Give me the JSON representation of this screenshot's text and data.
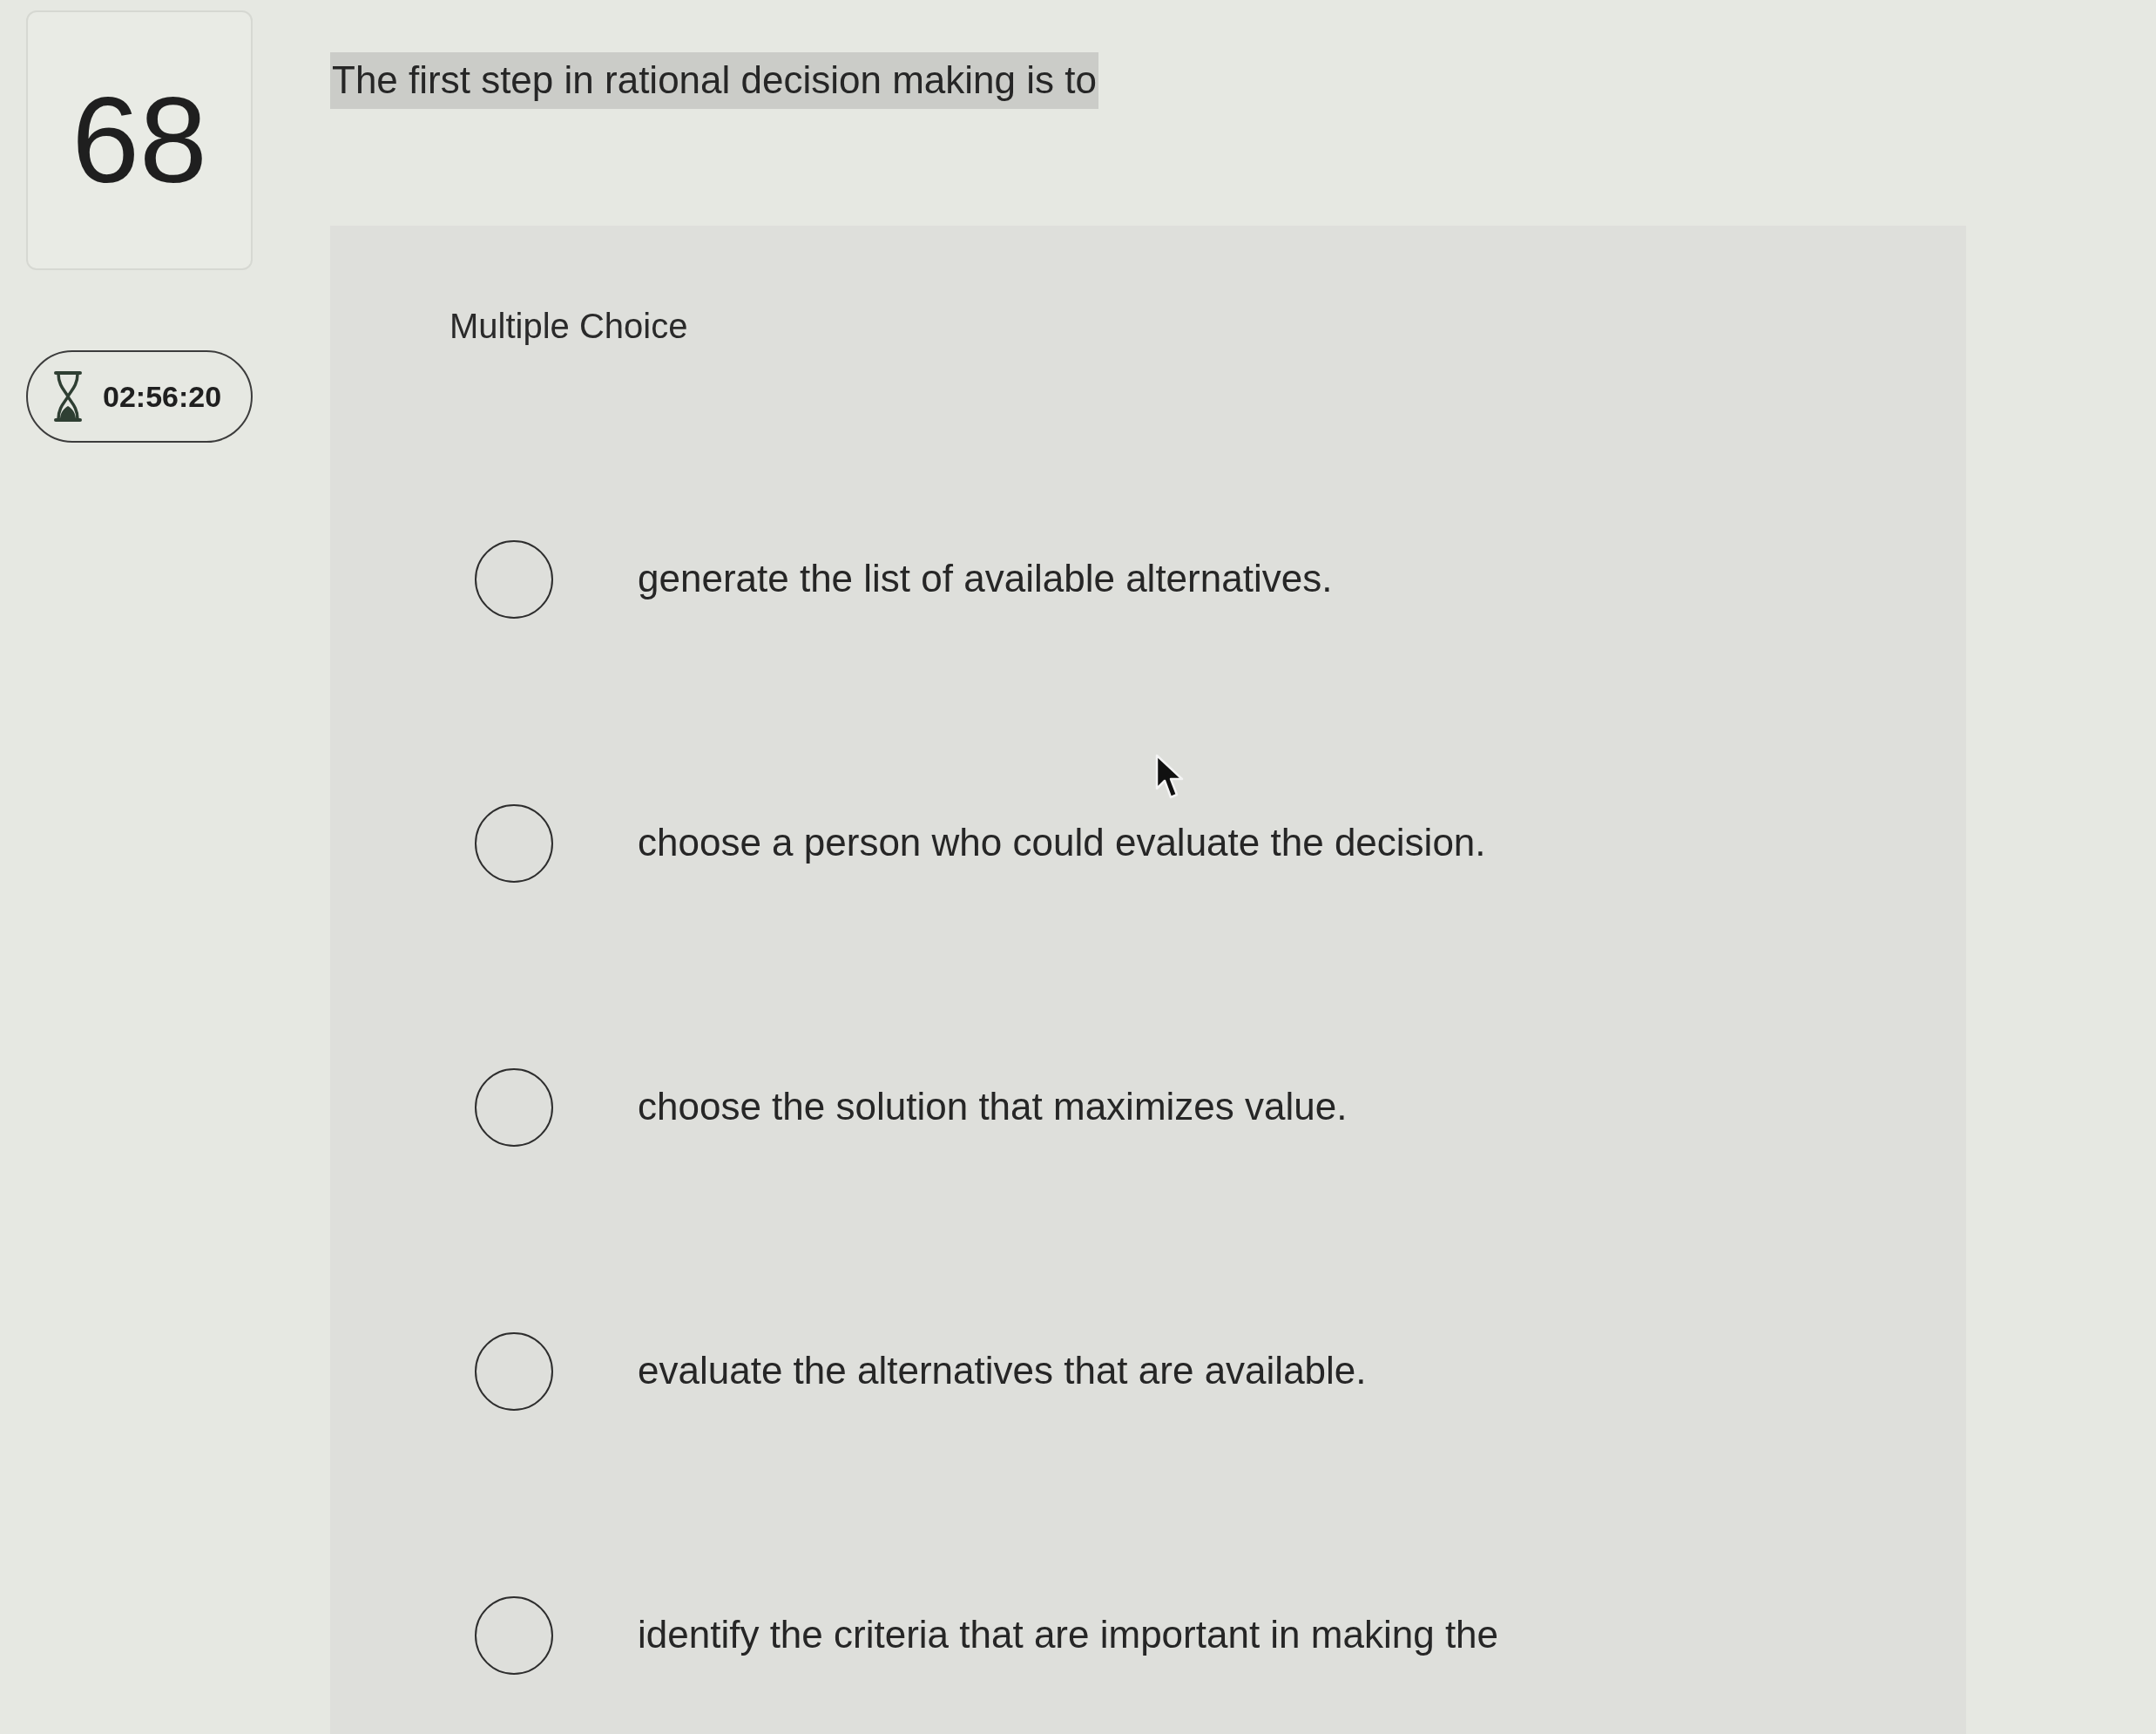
{
  "question": {
    "number": "68",
    "text": "The first step in rational decision making is to",
    "highlighted": true
  },
  "timer": {
    "time": "02:56:20"
  },
  "answer_panel": {
    "type_label": "Multiple Choice",
    "options": [
      {
        "text": "generate the list of available alternatives.",
        "selected": false
      },
      {
        "text": "choose a person who could evaluate the decision.",
        "selected": false
      },
      {
        "text": "choose the solution that maximizes value.",
        "selected": false
      },
      {
        "text": "evaluate the alternatives that are available.",
        "selected": false
      },
      {
        "text": "identify the criteria that are important in making the",
        "selected": false
      }
    ]
  }
}
